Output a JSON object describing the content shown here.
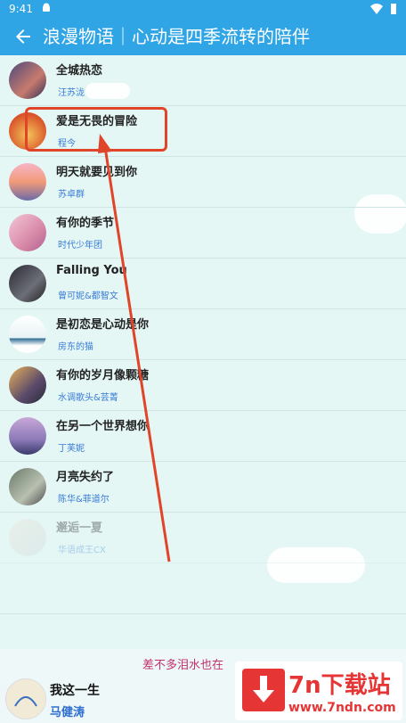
{
  "status_bar": {
    "time": "9:41"
  },
  "header": {
    "title": "浪漫物语｜心动是四季流转的陪伴"
  },
  "songs": [
    {
      "title": "全城热恋",
      "artist": "汪苏泷"
    },
    {
      "title": "爱是无畏的冒险",
      "artist": "程今"
    },
    {
      "title": "明天就要见到你",
      "artist": "苏卓群"
    },
    {
      "title": "有你的季节",
      "artist": "时代少年团"
    },
    {
      "title": "Falling You",
      "artist": "曾可妮&都智文"
    },
    {
      "title": "是初恋是心动是你",
      "artist": "房东的猫"
    },
    {
      "title": "有你的岁月像颗糖",
      "artist": "水调歌头&芸菁"
    },
    {
      "title": "在另一个世界想你",
      "artist": "丁芙妮"
    },
    {
      "title": "月亮失约了",
      "artist": "陈华&菲道尔"
    },
    {
      "title": "邂逅一夏",
      "artist": "华语成王CX"
    }
  ],
  "player": {
    "lyric": "差不多泪水也在",
    "title": "我这一生",
    "artist": "马健涛"
  },
  "watermark": {
    "title": "7n下载站",
    "url": "www.7ndn.com"
  },
  "colors": {
    "header": "#2fa5e6",
    "background": "#e4f7f5",
    "highlight": "#e0452a"
  }
}
